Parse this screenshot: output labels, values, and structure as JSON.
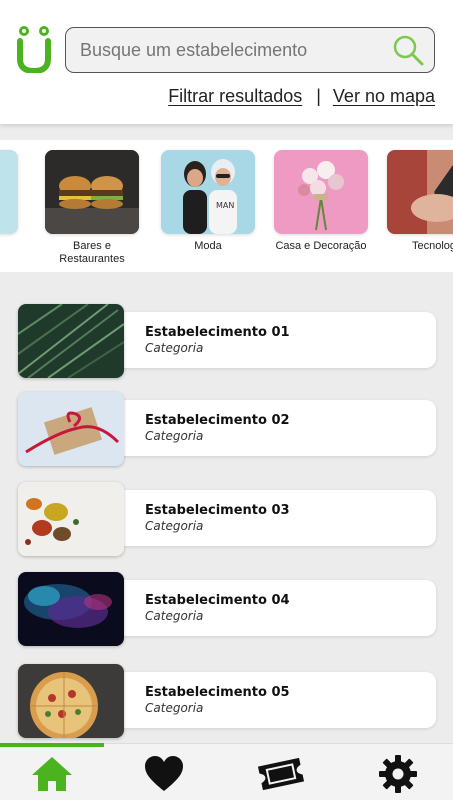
{
  "header": {
    "search_placeholder": "Busque um estabelecimento",
    "filter_label": "Filtrar resultados",
    "separator": "|",
    "map_label": "Ver no mapa"
  },
  "categories": [
    {
      "label": "",
      "icon": "partial-category-image"
    },
    {
      "label": "Bares e Restaurantes",
      "icon": "burgers-image"
    },
    {
      "label": "Moda",
      "icon": "fashion-image"
    },
    {
      "label": "Casa e Decoração",
      "icon": "flowers-image"
    },
    {
      "label": "Tecnolog",
      "icon": "phone-hand-image"
    }
  ],
  "establishments": [
    {
      "name": "Estabelecimento 01",
      "category": "Categoria",
      "image": "palm-leaves-image"
    },
    {
      "name": "Estabelecimento 02",
      "category": "Categoria",
      "image": "gift-box-image"
    },
    {
      "name": "Estabelecimento 03",
      "category": "Categoria",
      "image": "spices-image"
    },
    {
      "name": "Estabelecimento 04",
      "category": "Categoria",
      "image": "nebula-image"
    },
    {
      "name": "Estabelecimento 05",
      "category": "Categoria",
      "image": "pizza-image"
    }
  ],
  "bottom_nav": {
    "items": [
      {
        "icon": "home-icon",
        "active": true
      },
      {
        "icon": "heart-icon",
        "active": false
      },
      {
        "icon": "ticket-icon",
        "active": false
      },
      {
        "icon": "gear-icon",
        "active": false
      }
    ],
    "accent_color": "#4cb320"
  },
  "colors": {
    "brand_green": "#4cb320",
    "background": "#ececec"
  }
}
